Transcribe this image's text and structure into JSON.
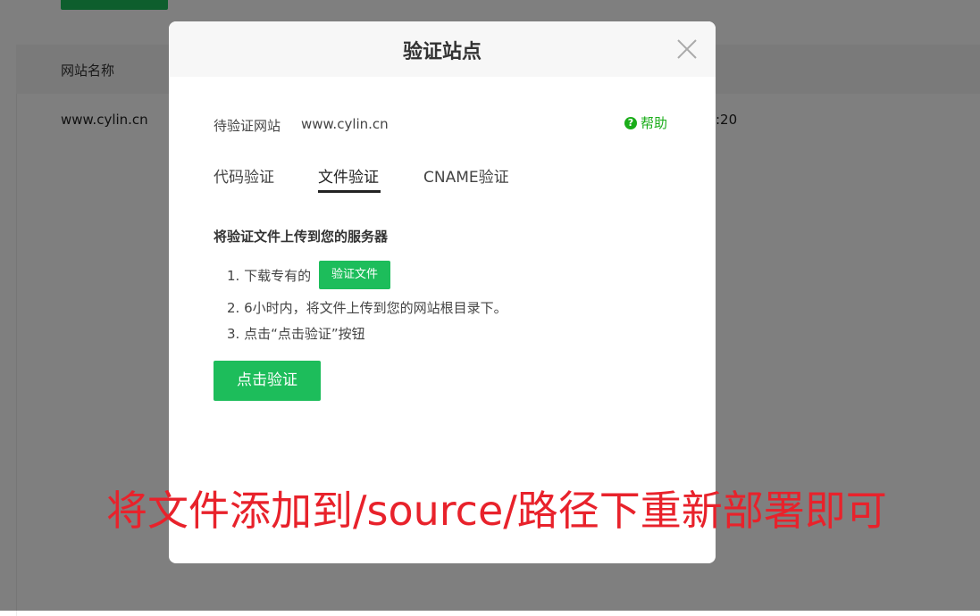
{
  "background": {
    "table_header_name": "网站名称",
    "row_site": "www.cylin.cn",
    "row_time_fragment": ":20"
  },
  "dialog": {
    "title": "验证站点",
    "pending_label": "待验证网站",
    "pending_site": "www.cylin.cn",
    "help_label": "帮助",
    "help_icon_glyph": "?",
    "tabs": [
      {
        "label": "代码验证",
        "active": false
      },
      {
        "label": "文件验证",
        "active": true
      },
      {
        "label": "CNAME验证",
        "active": false
      }
    ],
    "section_title": "将验证文件上传到您的服务器",
    "step1_text": "1. 下载专有的",
    "file_button_label": "验证文件",
    "step2_text": "2. 6小时内，将文件上传到您的网站根目录下。",
    "step3_text": "3. 点击“点击验证”按钮",
    "verify_button_label": "点击验证"
  },
  "annotation_text": "将文件添加到/source/路径下重新部署即可",
  "colors": {
    "accent_green": "#1dbd5b",
    "annotation_red": "#e8222b",
    "overlay": "rgba(0,0,0,0.5)"
  }
}
